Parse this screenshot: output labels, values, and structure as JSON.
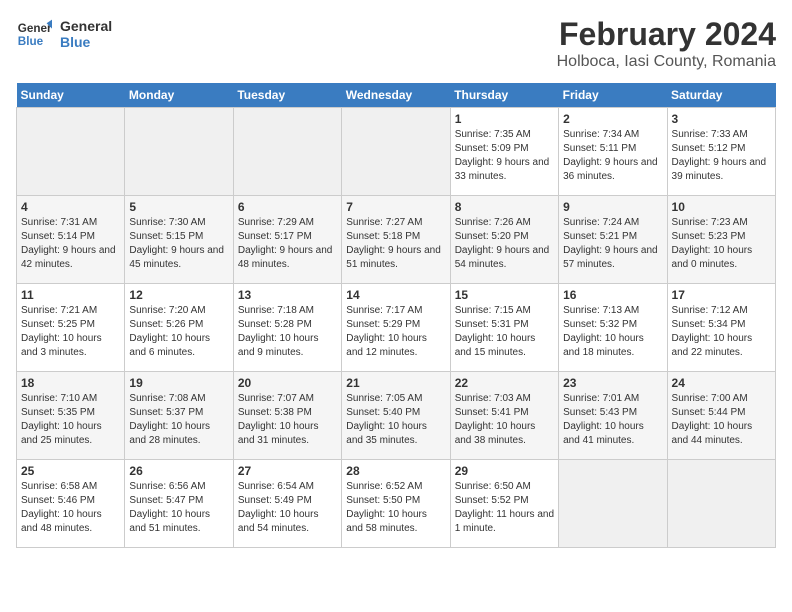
{
  "header": {
    "logo_general": "General",
    "logo_blue": "Blue",
    "title": "February 2024",
    "subtitle": "Holboca, Iasi County, Romania"
  },
  "days_of_week": [
    "Sunday",
    "Monday",
    "Tuesday",
    "Wednesday",
    "Thursday",
    "Friday",
    "Saturday"
  ],
  "weeks": [
    [
      {
        "day": "",
        "empty": true
      },
      {
        "day": "",
        "empty": true
      },
      {
        "day": "",
        "empty": true
      },
      {
        "day": "",
        "empty": true
      },
      {
        "day": "1",
        "sunrise": "Sunrise: 7:35 AM",
        "sunset": "Sunset: 5:09 PM",
        "daylight": "Daylight: 9 hours and 33 minutes."
      },
      {
        "day": "2",
        "sunrise": "Sunrise: 7:34 AM",
        "sunset": "Sunset: 5:11 PM",
        "daylight": "Daylight: 9 hours and 36 minutes."
      },
      {
        "day": "3",
        "sunrise": "Sunrise: 7:33 AM",
        "sunset": "Sunset: 5:12 PM",
        "daylight": "Daylight: 9 hours and 39 minutes."
      }
    ],
    [
      {
        "day": "4",
        "sunrise": "Sunrise: 7:31 AM",
        "sunset": "Sunset: 5:14 PM",
        "daylight": "Daylight: 9 hours and 42 minutes."
      },
      {
        "day": "5",
        "sunrise": "Sunrise: 7:30 AM",
        "sunset": "Sunset: 5:15 PM",
        "daylight": "Daylight: 9 hours and 45 minutes."
      },
      {
        "day": "6",
        "sunrise": "Sunrise: 7:29 AM",
        "sunset": "Sunset: 5:17 PM",
        "daylight": "Daylight: 9 hours and 48 minutes."
      },
      {
        "day": "7",
        "sunrise": "Sunrise: 7:27 AM",
        "sunset": "Sunset: 5:18 PM",
        "daylight": "Daylight: 9 hours and 51 minutes."
      },
      {
        "day": "8",
        "sunrise": "Sunrise: 7:26 AM",
        "sunset": "Sunset: 5:20 PM",
        "daylight": "Daylight: 9 hours and 54 minutes."
      },
      {
        "day": "9",
        "sunrise": "Sunrise: 7:24 AM",
        "sunset": "Sunset: 5:21 PM",
        "daylight": "Daylight: 9 hours and 57 minutes."
      },
      {
        "day": "10",
        "sunrise": "Sunrise: 7:23 AM",
        "sunset": "Sunset: 5:23 PM",
        "daylight": "Daylight: 10 hours and 0 minutes."
      }
    ],
    [
      {
        "day": "11",
        "sunrise": "Sunrise: 7:21 AM",
        "sunset": "Sunset: 5:25 PM",
        "daylight": "Daylight: 10 hours and 3 minutes."
      },
      {
        "day": "12",
        "sunrise": "Sunrise: 7:20 AM",
        "sunset": "Sunset: 5:26 PM",
        "daylight": "Daylight: 10 hours and 6 minutes."
      },
      {
        "day": "13",
        "sunrise": "Sunrise: 7:18 AM",
        "sunset": "Sunset: 5:28 PM",
        "daylight": "Daylight: 10 hours and 9 minutes."
      },
      {
        "day": "14",
        "sunrise": "Sunrise: 7:17 AM",
        "sunset": "Sunset: 5:29 PM",
        "daylight": "Daylight: 10 hours and 12 minutes."
      },
      {
        "day": "15",
        "sunrise": "Sunrise: 7:15 AM",
        "sunset": "Sunset: 5:31 PM",
        "daylight": "Daylight: 10 hours and 15 minutes."
      },
      {
        "day": "16",
        "sunrise": "Sunrise: 7:13 AM",
        "sunset": "Sunset: 5:32 PM",
        "daylight": "Daylight: 10 hours and 18 minutes."
      },
      {
        "day": "17",
        "sunrise": "Sunrise: 7:12 AM",
        "sunset": "Sunset: 5:34 PM",
        "daylight": "Daylight: 10 hours and 22 minutes."
      }
    ],
    [
      {
        "day": "18",
        "sunrise": "Sunrise: 7:10 AM",
        "sunset": "Sunset: 5:35 PM",
        "daylight": "Daylight: 10 hours and 25 minutes."
      },
      {
        "day": "19",
        "sunrise": "Sunrise: 7:08 AM",
        "sunset": "Sunset: 5:37 PM",
        "daylight": "Daylight: 10 hours and 28 minutes."
      },
      {
        "day": "20",
        "sunrise": "Sunrise: 7:07 AM",
        "sunset": "Sunset: 5:38 PM",
        "daylight": "Daylight: 10 hours and 31 minutes."
      },
      {
        "day": "21",
        "sunrise": "Sunrise: 7:05 AM",
        "sunset": "Sunset: 5:40 PM",
        "daylight": "Daylight: 10 hours and 35 minutes."
      },
      {
        "day": "22",
        "sunrise": "Sunrise: 7:03 AM",
        "sunset": "Sunset: 5:41 PM",
        "daylight": "Daylight: 10 hours and 38 minutes."
      },
      {
        "day": "23",
        "sunrise": "Sunrise: 7:01 AM",
        "sunset": "Sunset: 5:43 PM",
        "daylight": "Daylight: 10 hours and 41 minutes."
      },
      {
        "day": "24",
        "sunrise": "Sunrise: 7:00 AM",
        "sunset": "Sunset: 5:44 PM",
        "daylight": "Daylight: 10 hours and 44 minutes."
      }
    ],
    [
      {
        "day": "25",
        "sunrise": "Sunrise: 6:58 AM",
        "sunset": "Sunset: 5:46 PM",
        "daylight": "Daylight: 10 hours and 48 minutes."
      },
      {
        "day": "26",
        "sunrise": "Sunrise: 6:56 AM",
        "sunset": "Sunset: 5:47 PM",
        "daylight": "Daylight: 10 hours and 51 minutes."
      },
      {
        "day": "27",
        "sunrise": "Sunrise: 6:54 AM",
        "sunset": "Sunset: 5:49 PM",
        "daylight": "Daylight: 10 hours and 54 minutes."
      },
      {
        "day": "28",
        "sunrise": "Sunrise: 6:52 AM",
        "sunset": "Sunset: 5:50 PM",
        "daylight": "Daylight: 10 hours and 58 minutes."
      },
      {
        "day": "29",
        "sunrise": "Sunrise: 6:50 AM",
        "sunset": "Sunset: 5:52 PM",
        "daylight": "Daylight: 11 hours and 1 minute."
      },
      {
        "day": "",
        "empty": true
      },
      {
        "day": "",
        "empty": true
      }
    ]
  ]
}
